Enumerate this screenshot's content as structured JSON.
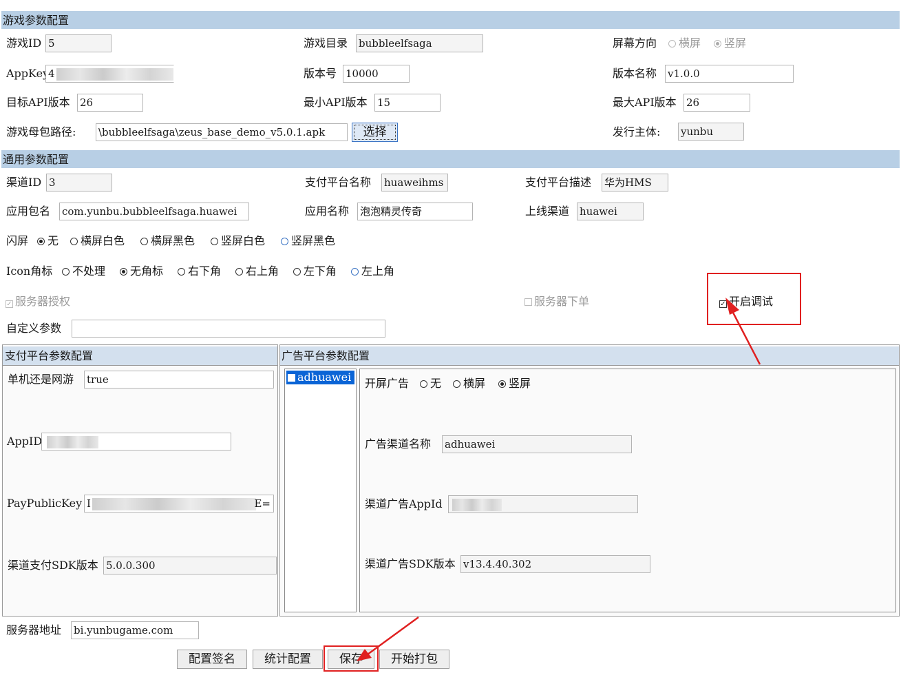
{
  "game_section": {
    "header": "游戏参数配置",
    "game_id_label": "游戏ID",
    "game_id_value": "5",
    "game_dir_label": "游戏目录",
    "game_dir_value": "bubbleelfsaga",
    "orientation_label": "屏幕方向",
    "orientation_options": [
      "横屏",
      "竖屏"
    ],
    "orientation_selected": "竖屏",
    "appkey_label": "AppKey",
    "appkey_value": "4",
    "version_code_label": "版本号",
    "version_code_value": "10000",
    "version_name_label": "版本名称",
    "version_name_value": "v1.0.0",
    "target_api_label": "目标API版本",
    "target_api_value": "26",
    "min_api_label": "最小API版本",
    "min_api_value": "15",
    "max_api_label": "最大API版本",
    "max_api_value": "26",
    "apk_path_label": "游戏母包路径:",
    "apk_path_value": "\\bubbleelfsaga\\zeus_base_demo_v5.0.1.apk",
    "choose_button": "选择",
    "publisher_label": "发行主体:",
    "publisher_value": "yunbu"
  },
  "common_section": {
    "header": "通用参数配置",
    "channel_id_label": "渠道ID",
    "channel_id_value": "3",
    "pay_name_label": "支付平台名称",
    "pay_name_value": "huaweihms",
    "pay_desc_label": "支付平台描述",
    "pay_desc_value": "华为HMS",
    "package_label": "应用包名",
    "package_value": "com.yunbu.bubbleelfsaga.huawei",
    "app_name_label": "应用名称",
    "app_name_value": "泡泡精灵传奇",
    "online_channel_label": "上线渠道",
    "online_channel_value": "huawei",
    "splash_label": "闪屏",
    "splash_options": [
      "无",
      "横屏白色",
      "横屏黑色",
      "竖屏白色",
      "竖屏黑色"
    ],
    "splash_selected": "无",
    "icon_label": "Icon角标",
    "icon_options": [
      "不处理",
      "无角标",
      "右下角",
      "右上角",
      "左下角",
      "左上角"
    ],
    "icon_selected": "无角标",
    "server_auth_label": "服务器授权",
    "server_order_label": "服务器下单",
    "debug_label": "开启调试",
    "custom_param_label": "自定义参数",
    "custom_param_value": ""
  },
  "pay_panel": {
    "header": "支付平台参数配置",
    "online_label": "单机还是网游",
    "online_value": "true",
    "appid_label": "AppID",
    "paykey_label": "PayPublicKey",
    "paykey_prefix": "I",
    "paykey_suffix": "E=",
    "sdk_version_label": "渠道支付SDK版本",
    "sdk_version_value": "5.0.0.300"
  },
  "ad_panel": {
    "header": "广告平台参数配置",
    "list_items": [
      "adhuawei"
    ],
    "splash_ad_label": "开屏广告",
    "splash_ad_options": [
      "无",
      "横屏",
      "竖屏"
    ],
    "splash_ad_selected": "竖屏",
    "ad_channel_label": "广告渠道名称",
    "ad_channel_value": "adhuawei",
    "ad_appid_label": "渠道广告AppId",
    "ad_sdk_label": "渠道广告SDK版本",
    "ad_sdk_value": "v13.4.40.302"
  },
  "footer": {
    "server_label": "服务器地址",
    "server_value": "bi.yunbugame.com",
    "buttons": [
      "配置签名",
      "统计配置",
      "保存",
      "开始打包"
    ]
  },
  "colors": {
    "section_header": "#b8cfe5",
    "annotation": "#e02020",
    "list_selection": "#0a64d6"
  }
}
